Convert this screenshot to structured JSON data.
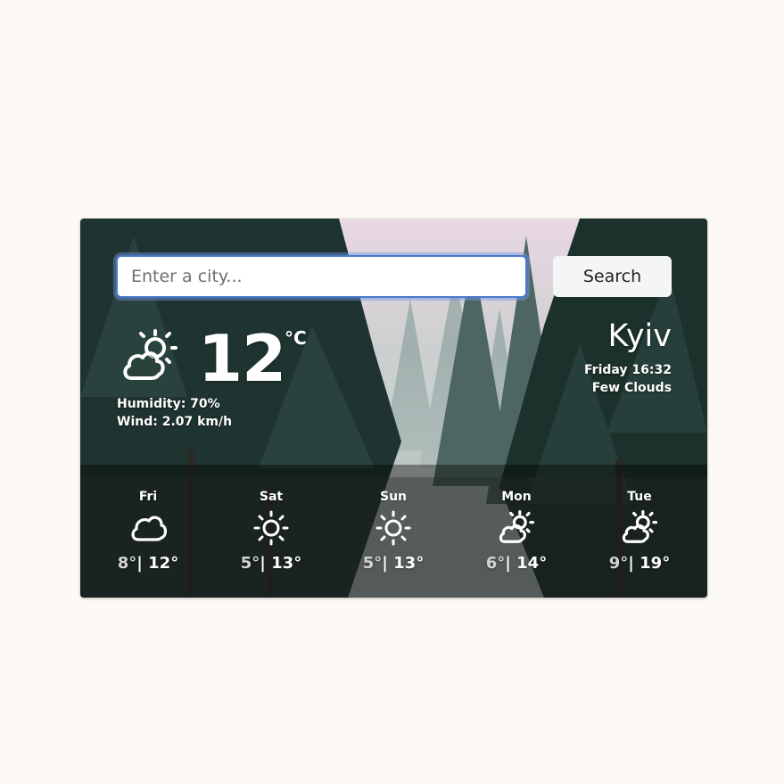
{
  "search": {
    "placeholder": "Enter a city...",
    "button_label": "Search"
  },
  "current": {
    "icon": "sun-behind-cloud-icon",
    "temperature": "12",
    "unit": "°C",
    "humidity": "Humidity: 70%",
    "wind": "Wind: 2.07 km/h",
    "city": "Kyiv",
    "datetime": "Friday 16:32",
    "description": "Few Clouds"
  },
  "forecast": [
    {
      "day": "Fri",
      "icon": "cloud-icon",
      "min": "8°",
      "sep": "|",
      "max": "12°"
    },
    {
      "day": "Sat",
      "icon": "sun-icon",
      "min": "5°",
      "sep": "|",
      "max": "13°"
    },
    {
      "day": "Sun",
      "icon": "sun-icon",
      "min": "5°",
      "sep": "|",
      "max": "13°"
    },
    {
      "day": "Mon",
      "icon": "sun-behind-cloud-icon",
      "min": "6°",
      "sep": "|",
      "max": "14°"
    },
    {
      "day": "Tue",
      "icon": "sun-behind-cloud-icon",
      "min": "9°",
      "sep": "|",
      "max": "19°"
    }
  ],
  "colors": {
    "page_background": "#fdf9f4",
    "input_focus_border": "#4a78c9",
    "button_background": "#f4f5f7",
    "forecast_overlay": "rgba(0,0,0,0.38)"
  }
}
